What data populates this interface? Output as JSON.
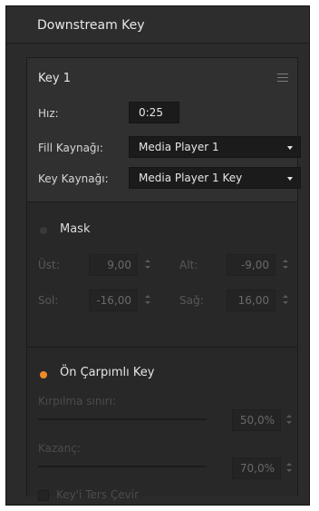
{
  "panel": {
    "title": "Downstream Key"
  },
  "key": {
    "title": "Key 1",
    "rate_label": "Hız:",
    "rate_value": "0:25",
    "fill_label": "Fill Kaynağı:",
    "fill_value": "Media Player 1",
    "key_label": "Key Kaynağı:",
    "key_value": "Media Player 1 Key"
  },
  "mask": {
    "title": "Mask",
    "enabled": false,
    "top_label": "Üst:",
    "top_value": "9,00",
    "bottom_label": "Alt:",
    "bottom_value": "-9,00",
    "left_label": "Sol:",
    "left_value": "-16,00",
    "right_label": "Sağ:",
    "right_value": "16,00"
  },
  "premult": {
    "title": "Ön Çarpımlı Key",
    "enabled": true,
    "clip_label": "Kırpılma sınırı:",
    "clip_value": "50,0%",
    "clip_fraction": 0.5,
    "gain_label": "Kazanç:",
    "gain_value": "70,0%",
    "gain_fraction": 0.7,
    "invert_label": "Key'i Ters Çevir",
    "invert_checked": false
  },
  "colors": {
    "accent_orange": "#f2892a",
    "panel_bg": "#2b2b2b",
    "field_bg": "#1b1b1b"
  },
  "icons": {
    "menu": "hamburger-menu-icon",
    "dropdown": "chevron-down-icon",
    "stepper": "spinner-arrows-icon"
  }
}
